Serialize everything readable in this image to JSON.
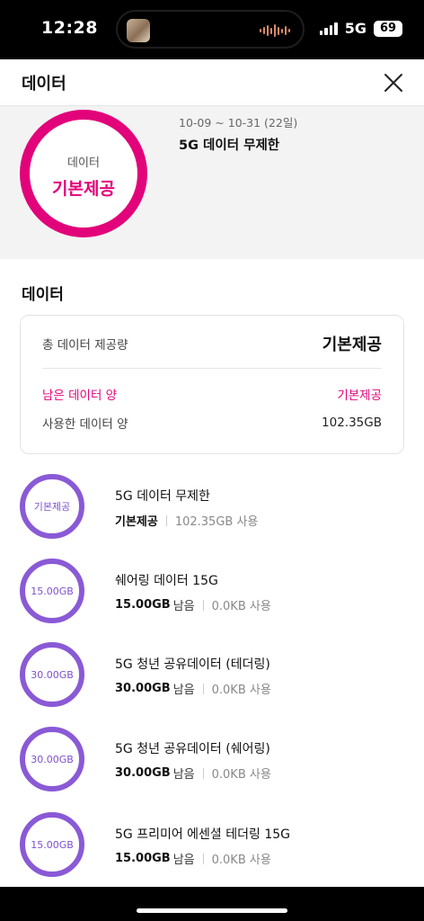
{
  "status_bar": {
    "time": "12:28",
    "network": "5G",
    "battery": "69"
  },
  "header": {
    "title": "데이터"
  },
  "summary": {
    "ring_label": "데이터",
    "ring_value": "기본제공",
    "period": "10-09 ~ 10-31 (22일)",
    "plan_name": "5G 데이터 무제한"
  },
  "section_title": "데이터",
  "totals": {
    "total_label": "총 데이터 제공량",
    "total_value": "기본제공",
    "remaining_label": "남은 데이터 양",
    "remaining_value": "기본제공",
    "used_label": "사용한 데이터 양",
    "used_value": "102.35GB"
  },
  "items": [
    {
      "ring": "기본제공",
      "name": "5G 데이터 무제한",
      "main": "기본제공",
      "suffix": "",
      "used": "102.35GB 사용"
    },
    {
      "ring": "15.00GB",
      "name": "쉐어링 데이터 15G",
      "main": "15.00GB",
      "suffix": "남음",
      "used": "0.0KB 사용"
    },
    {
      "ring": "30.00GB",
      "name": "5G 청년 공유데이터 (테더링)",
      "main": "30.00GB",
      "suffix": "남음",
      "used": "0.0KB 사용"
    },
    {
      "ring": "30.00GB",
      "name": "5G 청년 공유데이터 (쉐어링)",
      "main": "30.00GB",
      "suffix": "남음",
      "used": "0.0KB 사용"
    },
    {
      "ring": "15.00GB",
      "name": "5G 프리미어 에센셜 테더링 15G",
      "main": "15.00GB",
      "suffix": "남음",
      "used": "0.0KB 사용"
    }
  ],
  "colors": {
    "accent": "#e2037a",
    "ring_purple": "#8a5ad6"
  },
  "icons": {
    "close": "close-icon"
  }
}
